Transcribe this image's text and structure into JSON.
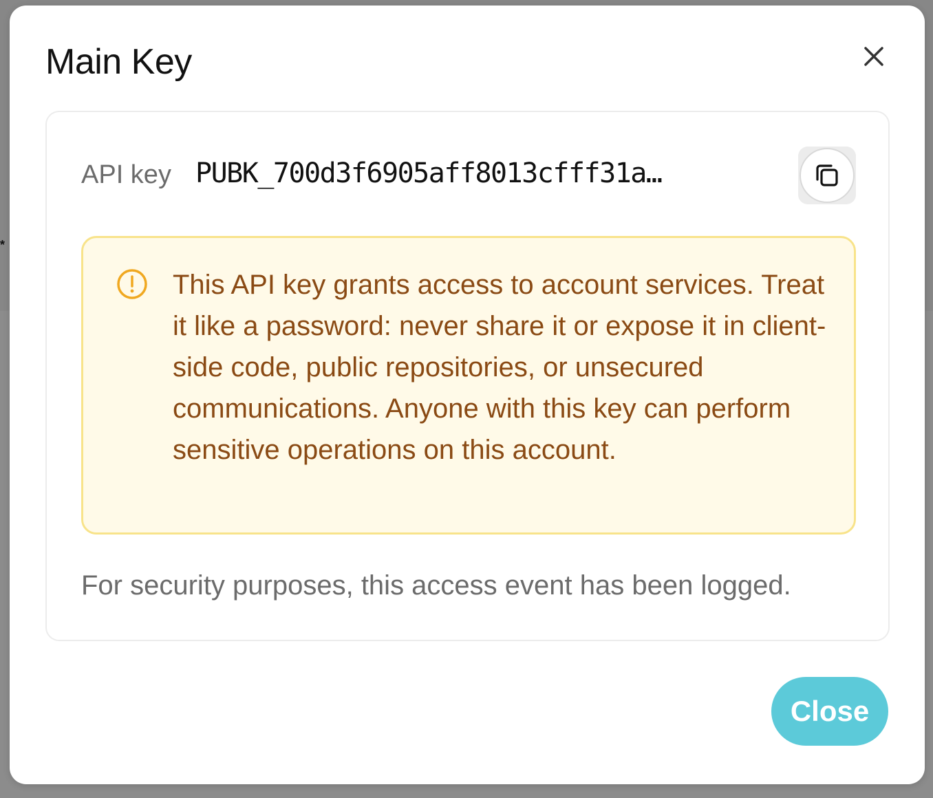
{
  "dialog": {
    "title": "Main Key",
    "close_icon": "close-icon"
  },
  "api_key": {
    "label": "API key",
    "value": "PUBK_700d3f6905aff8013cfff31a…",
    "copy_icon": "copy-icon"
  },
  "warning": {
    "icon": "alert-circle-icon",
    "text": "This API key grants access to account services. Treat it like a password: never share it or expose it in client-side code, public repositories, or unsecured communications. Anyone with this key can perform sensitive operations on this account.",
    "text_color": "#8a4a14",
    "background_color": "#fffae8",
    "border_color": "#f8e38a",
    "icon_color": "#f0a820"
  },
  "note": "For security purposes, this access event has been logged.",
  "footer": {
    "close_label": "Close",
    "close_color": "#5ccad9"
  }
}
